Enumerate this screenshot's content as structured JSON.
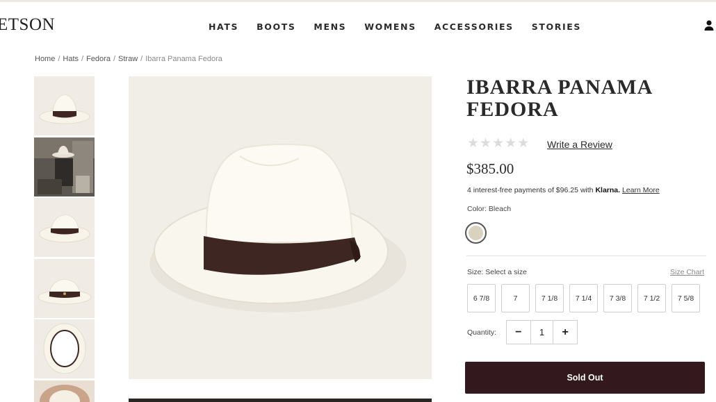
{
  "header": {
    "logo": "ETSON",
    "nav": [
      "HATS",
      "BOOTS",
      "MENS",
      "WOMENS",
      "ACCESSORIES",
      "STORIES"
    ]
  },
  "breadcrumb": {
    "items": [
      "Home",
      "Hats",
      "Fedora",
      "Straw"
    ],
    "current": "Ibarra Panama Fedora"
  },
  "product": {
    "title": "IBARRA PANAMA FEDORA",
    "rating_stars": 0,
    "review_link": "Write a Review",
    "price": "$385.00",
    "klarna": {
      "text": "4 interest-free payments of $96.25 with ",
      "brand": "Klarna.",
      "link": "Learn More"
    },
    "color_label": "Color: Bleach",
    "color_swatch": "#d9d2bf",
    "size_label": "Size: Select a size",
    "size_chart": "Size Chart",
    "sizes": [
      "6 7/8",
      "7",
      "7 1/8",
      "7 1/4",
      "7 3/8",
      "7 1/2",
      "7 5/8"
    ],
    "quantity_label": "Quantity:",
    "quantity": "1",
    "minus": "−",
    "plus": "+",
    "button": "Sold Out",
    "button_color": "#33181d"
  }
}
